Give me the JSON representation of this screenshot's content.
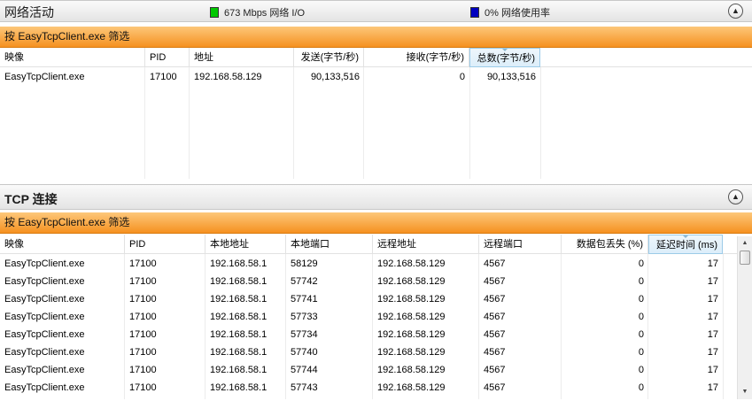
{
  "network_activity": {
    "title": "网络活动",
    "legend_io": "673 Mbps 网络 I/O",
    "legend_io_color": "#00c800",
    "legend_usage": "0% 网络使用率",
    "legend_usage_color": "#0000c0",
    "collapse_icon": "chevron-up-icon",
    "filter_text": "按 EasyTcpClient.exe 筛选",
    "columns": [
      "映像",
      "PID",
      "地址",
      "发送(字节/秒)",
      "接收(字节/秒)",
      "总数(字节/秒)"
    ],
    "rows": [
      [
        "EasyTcpClient.exe",
        "17100",
        "192.168.58.129",
        "90,133,516",
        "0",
        "90,133,516"
      ]
    ]
  },
  "tcp_connections": {
    "title": "TCP 连接",
    "collapse_icon": "chevron-up-icon",
    "filter_text": "按 EasyTcpClient.exe 筛选",
    "columns": [
      "映像",
      "PID",
      "本地地址",
      "本地端口",
      "远程地址",
      "远程端口",
      "数据包丢失 (%)",
      "延迟时间 (ms)"
    ],
    "rows": [
      [
        "EasyTcpClient.exe",
        "17100",
        "192.168.58.1",
        "58129",
        "192.168.58.129",
        "4567",
        "0",
        "17"
      ],
      [
        "EasyTcpClient.exe",
        "17100",
        "192.168.58.1",
        "57742",
        "192.168.58.129",
        "4567",
        "0",
        "17"
      ],
      [
        "EasyTcpClient.exe",
        "17100",
        "192.168.58.1",
        "57741",
        "192.168.58.129",
        "4567",
        "0",
        "17"
      ],
      [
        "EasyTcpClient.exe",
        "17100",
        "192.168.58.1",
        "57733",
        "192.168.58.129",
        "4567",
        "0",
        "17"
      ],
      [
        "EasyTcpClient.exe",
        "17100",
        "192.168.58.1",
        "57734",
        "192.168.58.129",
        "4567",
        "0",
        "17"
      ],
      [
        "EasyTcpClient.exe",
        "17100",
        "192.168.58.1",
        "57740",
        "192.168.58.129",
        "4567",
        "0",
        "17"
      ],
      [
        "EasyTcpClient.exe",
        "17100",
        "192.168.58.1",
        "57744",
        "192.168.58.129",
        "4567",
        "0",
        "17"
      ],
      [
        "EasyTcpClient.exe",
        "17100",
        "192.168.58.1",
        "57743",
        "192.168.58.129",
        "4567",
        "0",
        "17"
      ]
    ]
  }
}
